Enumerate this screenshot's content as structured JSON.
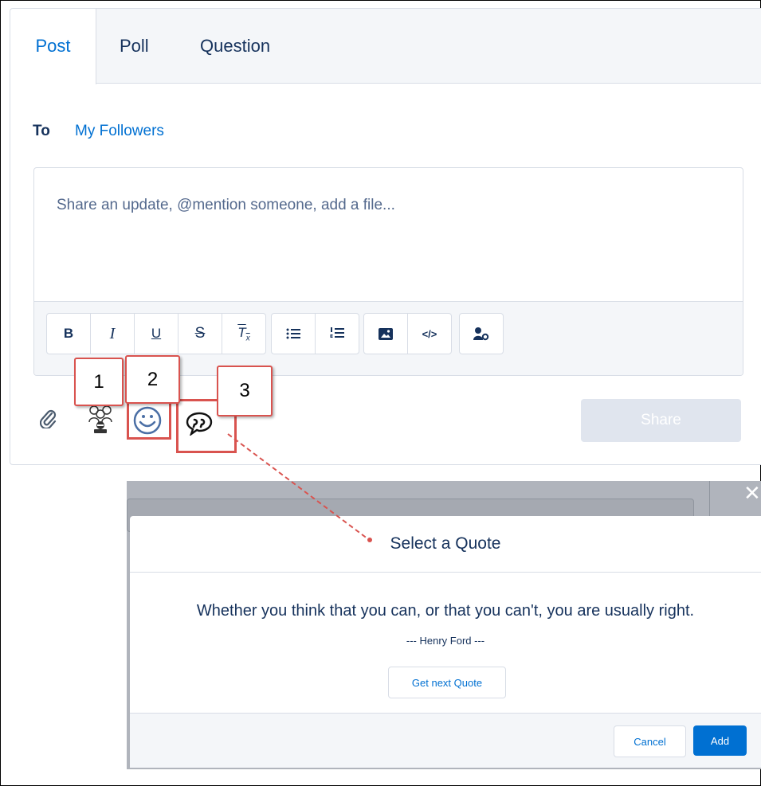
{
  "tabs": [
    {
      "label": "Post",
      "active": true
    },
    {
      "label": "Poll",
      "active": false
    },
    {
      "label": "Question",
      "active": false
    }
  ],
  "to": {
    "label": "To",
    "value": "My Followers"
  },
  "composer": {
    "placeholder": "Share an update, @mention someone, add a file..."
  },
  "toolbar": {
    "groups": [
      [
        "bold-icon",
        "italic-icon",
        "underline-icon",
        "strikethrough-icon",
        "remove-format-icon"
      ],
      [
        "bulleted-list-icon",
        "numbered-list-icon"
      ],
      [
        "image-icon",
        "code-icon"
      ],
      [
        "mention-user-icon"
      ]
    ],
    "bold_glyph": "B",
    "italic_glyph": "I",
    "underline_glyph": "U",
    "strike_glyph": "S",
    "clear_glyph": "T",
    "clear_sub": "x",
    "code_glyph": "</>"
  },
  "bottom_icons": [
    "attachment-icon",
    "people-icon",
    "smiley-icon",
    "quote-icon"
  ],
  "share_button": {
    "label": "Share"
  },
  "callouts": [
    "1",
    "2",
    "3"
  ],
  "modal": {
    "title": "Select a Quote",
    "quote": "Whether you think that you can, or that you can't, you are usually right.",
    "author": "--- Henry Ford ---",
    "next_button": "Get next Quote",
    "cancel_button": "Cancel",
    "add_button": "Add",
    "close_glyph": "✕"
  },
  "colors": {
    "brand_blue": "#0070d2",
    "text_dark": "#16325c",
    "callout_red": "#d9534f",
    "border": "#d8dde6"
  }
}
